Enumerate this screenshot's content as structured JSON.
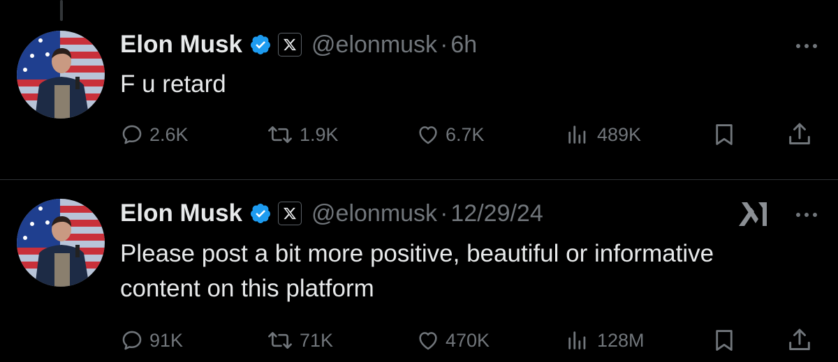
{
  "tweets": [
    {
      "author_name": "Elon Musk",
      "handle": "@elonmusk",
      "separator": "·",
      "time": "6h",
      "text": "F u retard",
      "stats": {
        "replies": "2.6K",
        "reposts": "1.9K",
        "likes": "6.7K",
        "views": "489K"
      },
      "icons": {
        "verified": "verified-badge-icon",
        "affiliation": "x-logo-icon",
        "more": "more-options-icon"
      }
    },
    {
      "author_name": "Elon Musk",
      "handle": "@elonmusk",
      "separator": "·",
      "time": "12/29/24",
      "text": "Please post a bit more positive, beautiful or informative content on this platform",
      "stats": {
        "replies": "91K",
        "reposts": "71K",
        "likes": "470K",
        "views": "128M"
      },
      "icons": {
        "verified": "verified-badge-icon",
        "affiliation": "x-logo-icon",
        "grok": "grok-icon",
        "more": "more-options-icon"
      }
    }
  ],
  "theme": {
    "background": "#000000",
    "text_primary": "#e7e9ea",
    "text_secondary": "#71767b",
    "verified_blue": "#1d9bf0",
    "divider": "#2f3336"
  }
}
